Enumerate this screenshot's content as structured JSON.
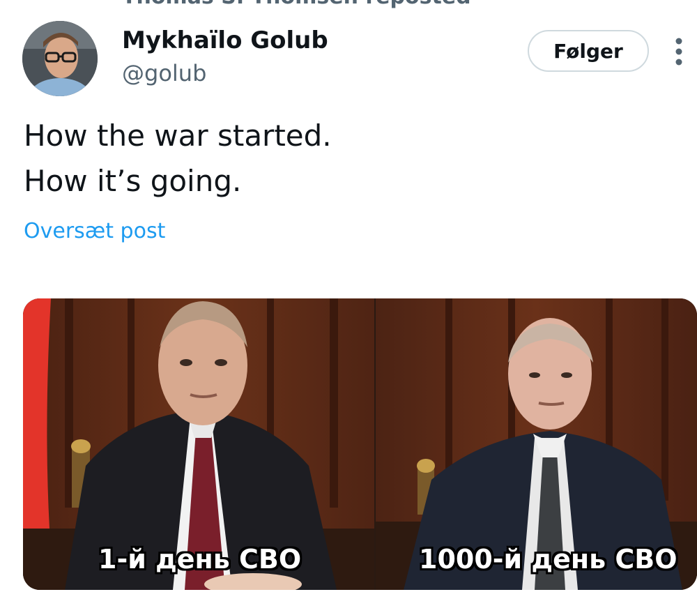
{
  "repost": {
    "text": "Thomas S. Thomsen reposted"
  },
  "author": {
    "display_name": "Mykhaïlo Golub",
    "handle": "@golub"
  },
  "header": {
    "follow_label": "Følger"
  },
  "tweet": {
    "lines": [
      "How the war started.",
      "How it’s going."
    ],
    "translate_label": "Oversæt post"
  },
  "media": {
    "captions": [
      "1-й день СВО",
      "1000-й день СВО"
    ]
  },
  "icons": {
    "more": "more-vertical-icon",
    "avatar": "avatar-photo"
  },
  "colors": {
    "link": "#1d9bf0",
    "secondary_text": "#536471",
    "primary_text": "#0f1419",
    "follow_border": "#cfd9de",
    "wood_panel": "#5b2a17",
    "flag_red": "#e3342a"
  }
}
